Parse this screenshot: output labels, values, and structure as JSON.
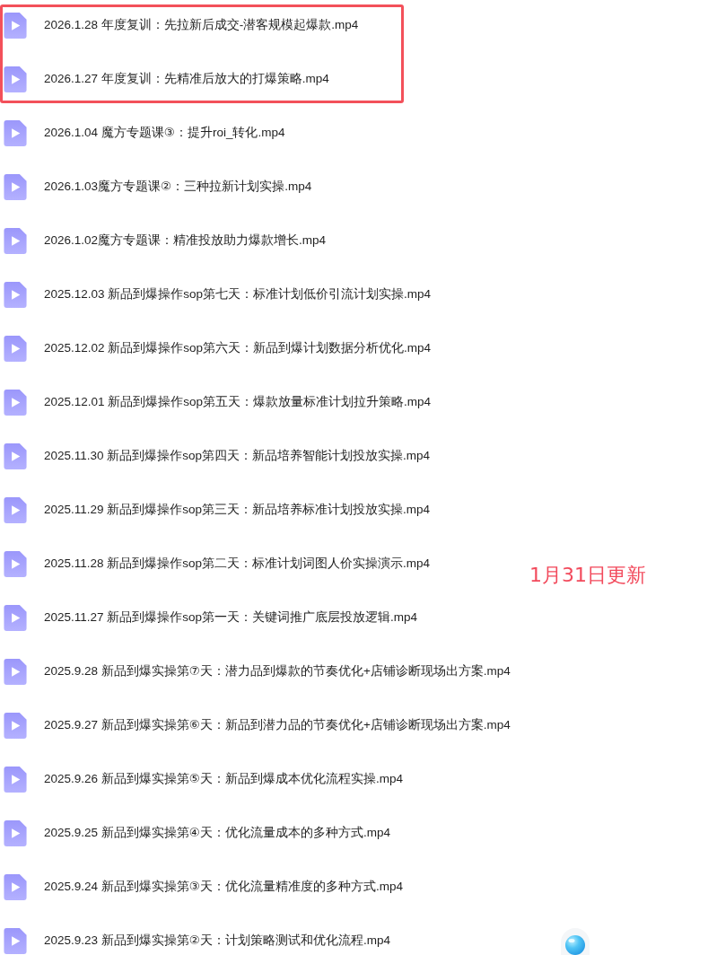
{
  "files": [
    {
      "name": "2026.1.28 年度复训：先拉新后成交-潜客规模起爆款.mp4",
      "highlighted": true
    },
    {
      "name": "2026.1.27 年度复训：先精准后放大的打爆策略.mp4",
      "highlighted": true
    },
    {
      "name": "2026.1.04 魔方专题课③：提升roi_转化.mp4",
      "highlighted": false
    },
    {
      "name": "2026.1.03魔方专题课②：三种拉新计划实操.mp4",
      "highlighted": false
    },
    {
      "name": "2026.1.02魔方专题课：精准投放助力爆款增长.mp4",
      "highlighted": false
    },
    {
      "name": "2025.12.03 新品到爆操作sop第七天：标准计划低价引流计划实操.mp4",
      "highlighted": false
    },
    {
      "name": "2025.12.02 新品到爆操作sop第六天：新品到爆计划数据分析优化.mp4",
      "highlighted": false
    },
    {
      "name": "2025.12.01 新品到爆操作sop第五天：爆款放量标准计划拉升策略.mp4",
      "highlighted": false
    },
    {
      "name": "2025.11.30 新品到爆操作sop第四天：新品培养智能计划投放实操.mp4",
      "highlighted": false
    },
    {
      "name": "2025.11.29 新品到爆操作sop第三天：新品培养标准计划投放实操.mp4",
      "highlighted": false
    },
    {
      "name": "2025.11.28 新品到爆操作sop第二天：标准计划词图人价实操演示.mp4",
      "highlighted": false
    },
    {
      "name": "2025.11.27 新品到爆操作sop第一天：关键词推广底层投放逻辑.mp4",
      "highlighted": false
    },
    {
      "name": "2025.9.28 新品到爆实操第⑦天：潜力品到爆款的节奏优化+店铺诊断现场出方案.mp4",
      "highlighted": false
    },
    {
      "name": "2025.9.27 新品到爆实操第⑥天：新品到潜力品的节奏优化+店铺诊断现场出方案.mp4",
      "highlighted": false
    },
    {
      "name": "2025.9.26 新品到爆实操第⑤天：新品到爆成本优化流程实操.mp4",
      "highlighted": false
    },
    {
      "name": "2025.9.25 新品到爆实操第④天：优化流量成本的多种方式.mp4",
      "highlighted": false
    },
    {
      "name": "2025.9.24 新品到爆实操第③天：优化流量精准度的多种方式.mp4",
      "highlighted": false
    },
    {
      "name": "2025.9.23 新品到爆实操第②天：计划策略测试和优化流程.mp4",
      "highlighted": false
    }
  ],
  "update_note": "1月31日更新"
}
